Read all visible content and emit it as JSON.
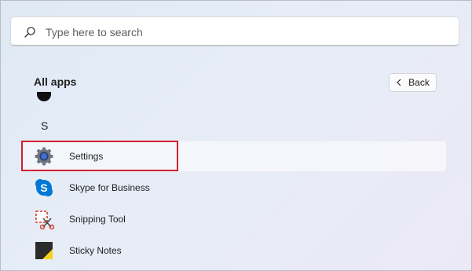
{
  "search": {
    "placeholder": "Type here to search",
    "icon": "search-icon"
  },
  "header": {
    "title": "All apps",
    "back_label": "Back"
  },
  "section": {
    "letter": "S"
  },
  "apps": [
    {
      "label": "Settings",
      "icon": "settings-gear-icon"
    },
    {
      "label": "Skype for Business",
      "icon": "skype-icon"
    },
    {
      "label": "Snipping Tool",
      "icon": "snipping-tool-icon"
    },
    {
      "label": "Sticky Notes",
      "icon": "sticky-notes-icon"
    }
  ],
  "colors": {
    "highlight_border": "#d21f2f",
    "skype_blue": "#0078d4",
    "sticky_yellow": "#f7d21d"
  }
}
